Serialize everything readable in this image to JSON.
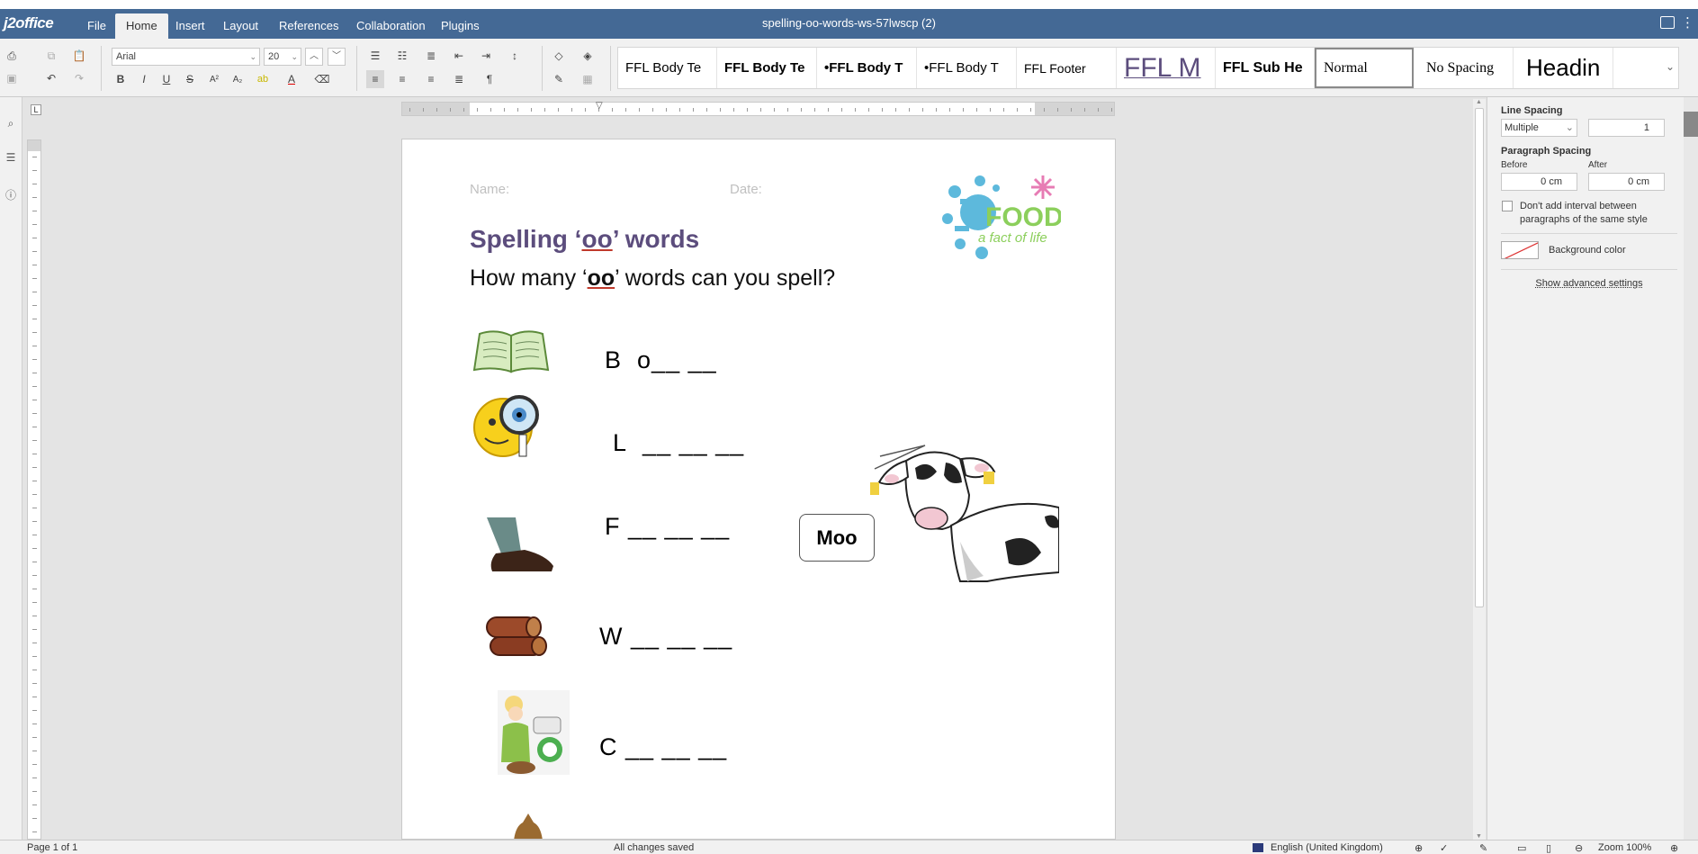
{
  "app": {
    "logo": "j2office",
    "doc_title": "spelling-oo-words-ws-57lwscp (2)"
  },
  "menu": {
    "tabs": [
      "File",
      "Home",
      "Insert",
      "Layout",
      "References",
      "Collaboration",
      "Plugins"
    ],
    "active": "Home"
  },
  "ribbon": {
    "font_name": "Arial",
    "font_size": "20",
    "styles": [
      "FFL Body Te",
      "FFL Body Te",
      "•FFL Body T",
      "•FFL Body T",
      "FFL Footer",
      "FFL M",
      "FFL Sub He",
      "Normal",
      "No Spacing",
      "Headin"
    ],
    "selected_style": "Normal"
  },
  "document": {
    "name_label": "Name:",
    "date_label": "Date:",
    "logo_text_main": "FOOD",
    "logo_text_sub": "a fact of life",
    "title_pre": "Spelling ‘",
    "title_oo": "oo",
    "title_post": "’ words",
    "subtitle_pre": "How many ‘",
    "subtitle_oo": "oo",
    "subtitle_post": "’ words can you spell?",
    "rows": [
      {
        "letter": "B",
        "blanks": "o__ __",
        "picture": "book"
      },
      {
        "letter": "L",
        "blanks": "__ __ __",
        "picture": "magnifier-face"
      },
      {
        "letter": "F",
        "blanks": "__ __ __",
        "picture": "foot"
      },
      {
        "letter": "W",
        "blanks": "__ __ __",
        "picture": "wood-logs"
      },
      {
        "letter": "C",
        "blanks": "__ __ __",
        "picture": "cook"
      }
    ],
    "speech_bubble": "Moo"
  },
  "right_panel": {
    "line_spacing_label": "Line Spacing",
    "line_spacing_mode": "Multiple",
    "line_spacing_value": "1",
    "paragraph_spacing_label": "Paragraph Spacing",
    "before_label": "Before",
    "after_label": "After",
    "before_value": "0 cm",
    "after_value": "0 cm",
    "dont_add_interval": "Don't add interval between paragraphs of the same style",
    "background_color_label": "Background color",
    "show_advanced": "Show advanced settings"
  },
  "statusbar": {
    "page_info": "Page 1 of 1",
    "save_status": "All changes saved",
    "language": "English (United Kingdom)",
    "zoom": "Zoom 100%"
  },
  "colors": {
    "menubar": "#446995",
    "title_purple": "#5c4d7d",
    "ribbon_bg": "#f1f1f1"
  }
}
